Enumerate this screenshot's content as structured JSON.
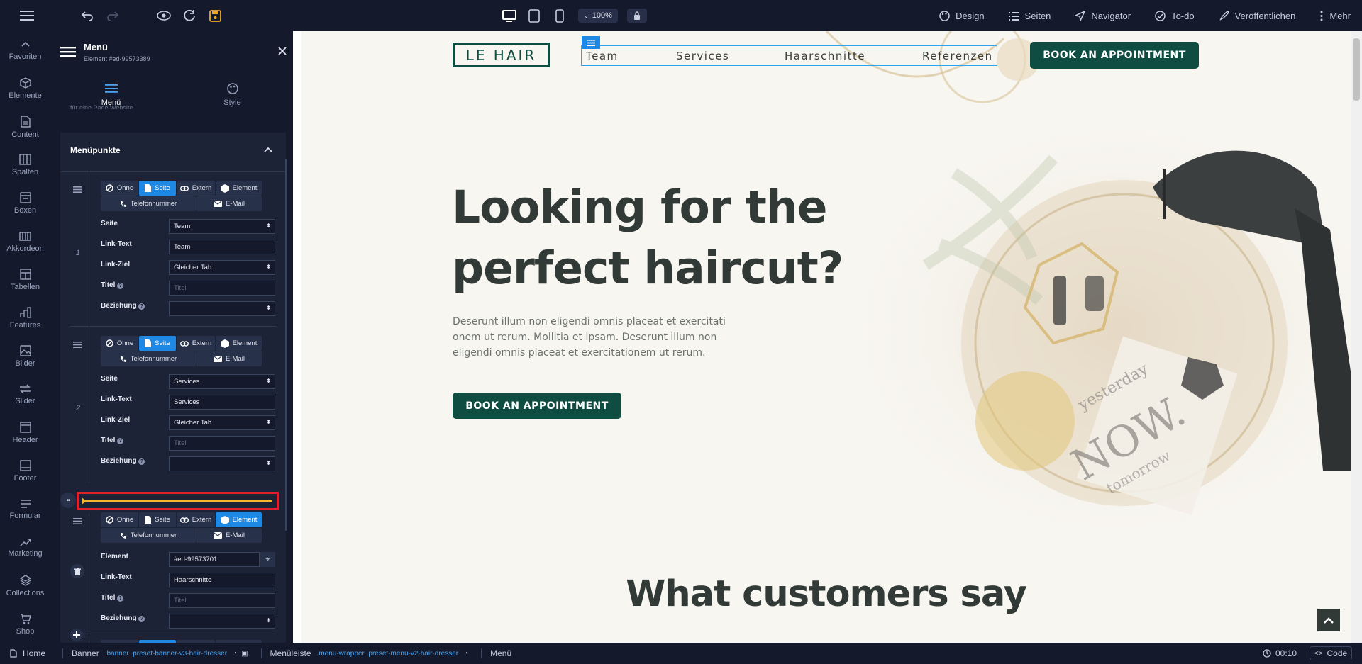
{
  "topbar": {
    "zoom": "100%",
    "menu_items": [
      {
        "label": "Design",
        "icon": "palette-icon"
      },
      {
        "label": "Seiten",
        "icon": "list-icon"
      },
      {
        "label": "Navigator",
        "icon": "navigation-icon"
      },
      {
        "label": "To-do",
        "icon": "check-circle-icon"
      },
      {
        "label": "Veröffentlichen",
        "icon": "rocket-icon"
      },
      {
        "label": "Mehr",
        "icon": "kebab-icon"
      }
    ]
  },
  "leftnav": [
    {
      "label": "Favoriten",
      "icon": "chevron-up-icon"
    },
    {
      "label": "Elemente",
      "icon": "cube-icon"
    },
    {
      "label": "Content",
      "icon": "document-icon"
    },
    {
      "label": "Spalten",
      "icon": "columns-icon"
    },
    {
      "label": "Boxen",
      "icon": "box-icon"
    },
    {
      "label": "Akkordeon",
      "icon": "accordion-icon"
    },
    {
      "label": "Tabellen",
      "icon": "table-icon"
    },
    {
      "label": "Features",
      "icon": "features-icon"
    },
    {
      "label": "Bilder",
      "icon": "image-icon"
    },
    {
      "label": "Slider",
      "icon": "slider-icon"
    },
    {
      "label": "Header",
      "icon": "header-icon"
    },
    {
      "label": "Footer",
      "icon": "footer-icon"
    },
    {
      "label": "Formular",
      "icon": "form-icon"
    },
    {
      "label": "Marketing",
      "icon": "trend-icon"
    },
    {
      "label": "Collections",
      "icon": "layers-icon"
    },
    {
      "label": "Shop",
      "icon": "cart-icon"
    }
  ],
  "panel": {
    "title": "Menü",
    "subtitle": "Element #ed-99573389",
    "tabs": [
      {
        "label": "Menü"
      },
      {
        "label": "Style"
      }
    ],
    "cut_text": "für eine Page Website",
    "section_title": "Menüpunkte",
    "type_labels": {
      "ohne": "Ohne",
      "seite": "Seite",
      "extern": "Extern",
      "element": "Element",
      "telefon": "Telefonnummer",
      "email": "E-Mail"
    },
    "field_labels": {
      "seite": "Seite",
      "linktext": "Link-Text",
      "linkziel": "Link-Ziel",
      "titel": "Titel",
      "beziehung": "Beziehung",
      "element": "Element"
    },
    "title_placeholder": "Titel",
    "items": [
      {
        "num": "1",
        "seite": "Team",
        "linktext": "Team",
        "linkziel": "Gleicher Tab"
      },
      {
        "num": "2",
        "seite": "Services",
        "linktext": "Services",
        "linkziel": "Gleicher Tab"
      },
      {
        "element": "#ed-99573701",
        "linktext": "Haarschnitte"
      }
    ]
  },
  "site": {
    "logo": "LE HAIR",
    "nav": [
      "Team",
      "Services",
      "Haarschnitte",
      "Referenzen"
    ],
    "book_button": "BOOK AN APPOINTMENT",
    "hero_title_line1": "Looking for the",
    "hero_title_line2": "perfect haircut?",
    "hero_text_line1": "Deserunt illum non eligendi omnis placeat et exercitati",
    "hero_text_line2": "onem ut rerum. Mollitia et ipsam. Deserunt illum non",
    "hero_text_line3": "eligendi omnis placeat et exercitationem ut rerum.",
    "card_text_1": "yesterday",
    "card_text_2": "NOW.",
    "card_text_3": "tomorrow",
    "section_heading": "What customers say"
  },
  "bottombar": {
    "crumbs": [
      {
        "label": "Home",
        "classes": ""
      },
      {
        "label": "Banner",
        "classes": ".banner .preset-banner-v3-hair-dresser"
      },
      {
        "label": "Menüleiste",
        "classes": ".menu-wrapper .preset-menu-v2-hair-dresser"
      },
      {
        "label": "Menü",
        "classes": ""
      }
    ],
    "time": "00:10",
    "code_label": "Code"
  },
  "colors": {
    "accent": "#1e88e5",
    "brand": "#0f4c42",
    "drop_indicator": "#f2b631",
    "highlight_box": "#e0212b"
  }
}
